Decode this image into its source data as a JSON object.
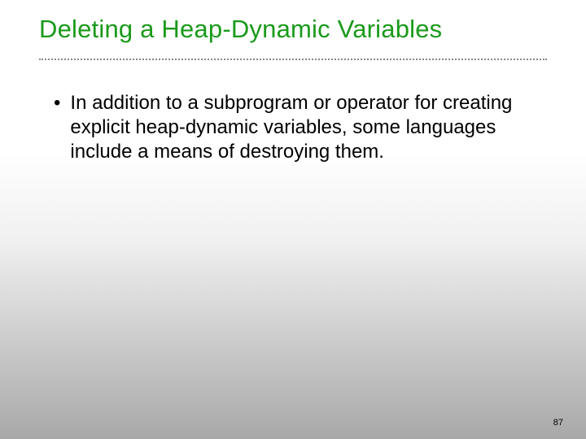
{
  "title": "Deleting a Heap-Dynamic Variables",
  "bullets": [
    {
      "marker": "•",
      "text": "In addition to a subprogram or operator for creating explicit heap-dynamic variables, some languages include a means of destroying them."
    }
  ],
  "page_number": "87"
}
